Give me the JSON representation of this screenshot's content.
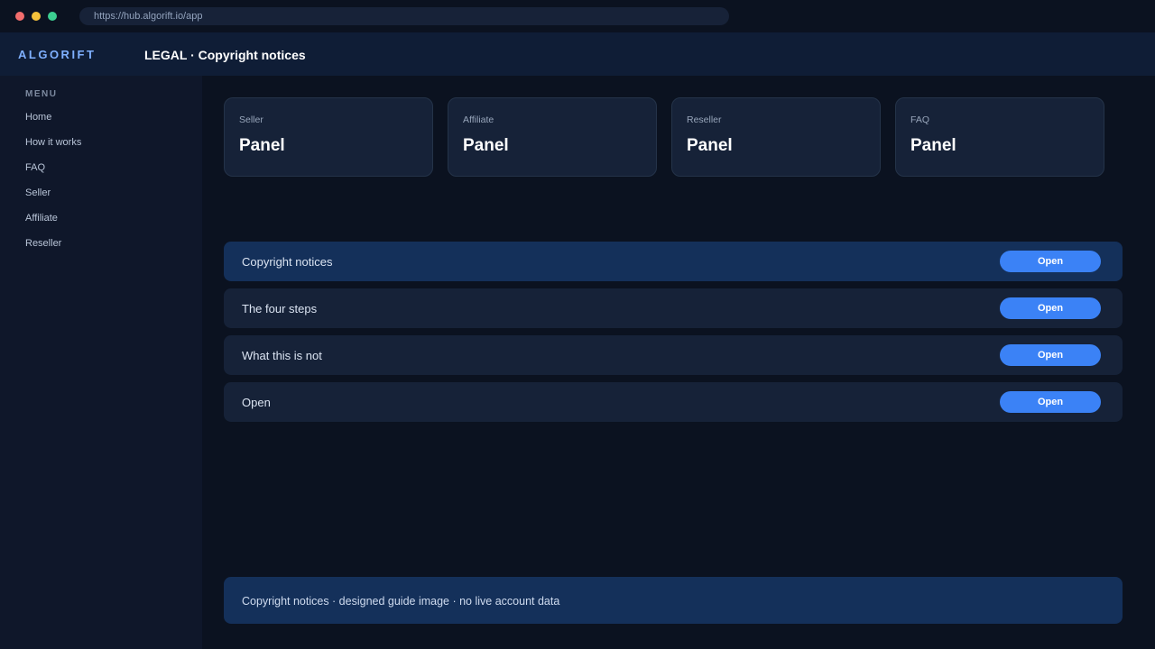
{
  "browser": {
    "url": "https://hub.algorift.io/app"
  },
  "header": {
    "brand": "ALGORIFT",
    "title": "LEGAL · Copyright notices"
  },
  "sidebar": {
    "menu_label": "MENU",
    "items": [
      {
        "label": "Home"
      },
      {
        "label": "How it works"
      },
      {
        "label": "FAQ"
      },
      {
        "label": "Seller"
      },
      {
        "label": "Affiliate"
      },
      {
        "label": "Reseller"
      }
    ]
  },
  "cards": [
    {
      "label": "Seller",
      "value": "Panel"
    },
    {
      "label": "Affiliate",
      "value": "Panel"
    },
    {
      "label": "Reseller",
      "value": "Panel"
    },
    {
      "label": "FAQ",
      "value": "Panel"
    }
  ],
  "rows": [
    {
      "label": "Copyright notices",
      "button": "Open",
      "active": true
    },
    {
      "label": "The four steps",
      "button": "Open",
      "active": false
    },
    {
      "label": "What this is not",
      "button": "Open",
      "active": false
    },
    {
      "label": "Open",
      "button": "Open",
      "active": false
    }
  ],
  "footer": {
    "text": "Copyright notices · designed guide image · no live account data"
  },
  "colors": {
    "accent": "#3b82f6",
    "brand": "#7fb0ff",
    "active_row": "#14305a"
  }
}
